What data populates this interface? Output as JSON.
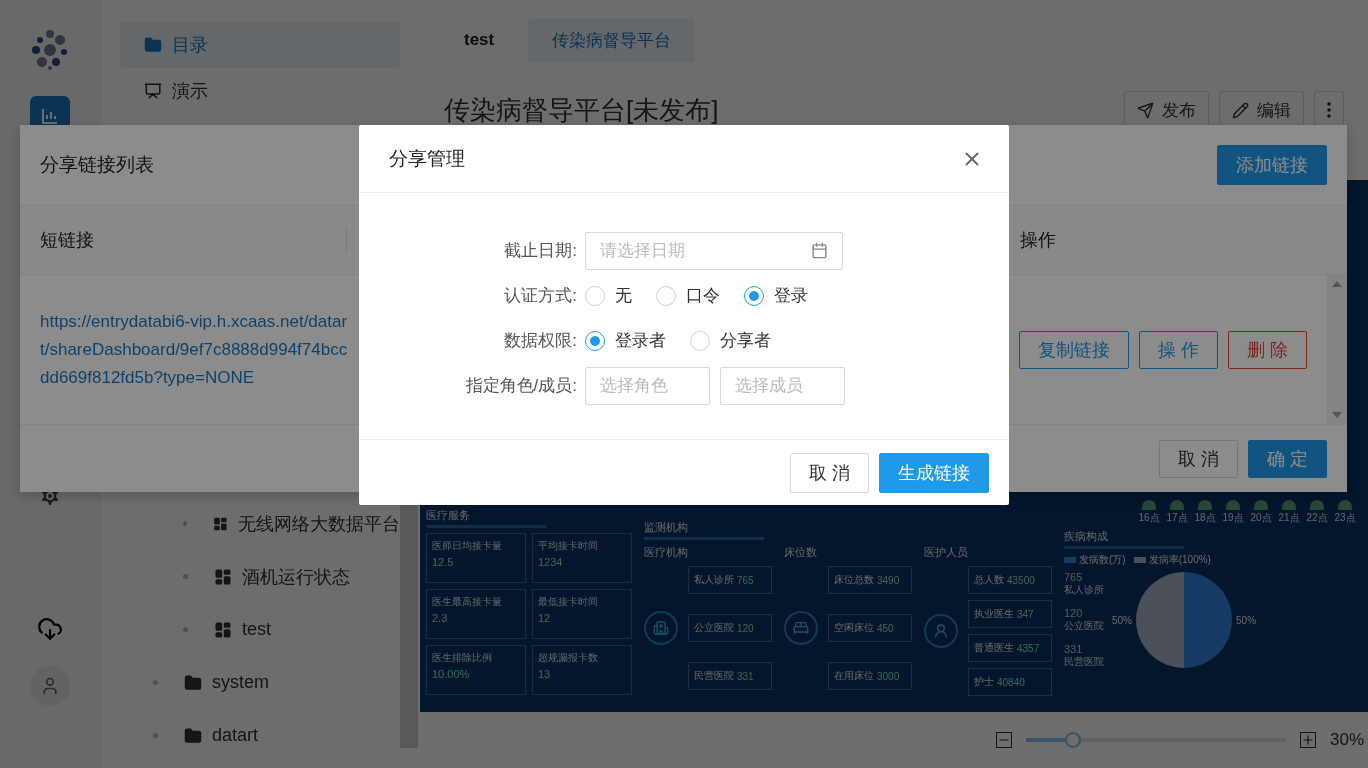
{
  "sidebar": {
    "sections": [
      {
        "label": "目录",
        "kind": "folder",
        "selected": true
      },
      {
        "label": "演示",
        "kind": "present",
        "selected": false
      }
    ],
    "tree": [
      {
        "children": [
          {
            "label": "无线网络大数据平台",
            "kind": "dashboard"
          },
          {
            "label": "酒机运行状态",
            "kind": "dashboard"
          },
          {
            "label": "test",
            "kind": "dashboard"
          }
        ]
      },
      {
        "label": "system",
        "kind": "folder"
      },
      {
        "label": "datart",
        "kind": "folder"
      }
    ]
  },
  "tabs": [
    {
      "label": "test",
      "selected": false
    },
    {
      "label": "传染病督导平台",
      "selected": true
    }
  ],
  "page_title": "传染病督导平台[未发布]",
  "toolbar": [
    {
      "kind": "publish",
      "label": "发布"
    },
    {
      "kind": "edit",
      "label": "编辑"
    },
    {
      "kind": "more"
    }
  ],
  "dashboard": {
    "hour_labels": [
      "16点",
      "17点",
      "18点",
      "19点",
      "20点",
      "21点",
      "22点",
      "23点"
    ],
    "service": {
      "title": "医疗服务",
      "cards": [
        {
          "label": "医师日均接卡量",
          "value": "12.5"
        },
        {
          "label": "平均接卡时间",
          "value": "1234"
        },
        {
          "label": "医生最高接卡量",
          "value": "2.3"
        },
        {
          "label": "最低接卡时间",
          "value": "12"
        },
        {
          "label": "医生排除比例",
          "value": "10.00%"
        },
        {
          "label": "超规漏报卡数",
          "value": "13"
        }
      ]
    },
    "monitor": {
      "title": "监测机构",
      "groups": [
        {
          "title": "医疗机构",
          "kind": "hospital",
          "items": [
            {
              "label": "私人诊所",
              "value": "765"
            },
            {
              "label": "公立医院",
              "value": "120"
            },
            {
              "label": "民营医院",
              "value": "331"
            }
          ]
        },
        {
          "title": "床位数",
          "kind": "bed",
          "items": [
            {
              "label": "床位总数",
              "value": "3490"
            },
            {
              "label": "空闲床位",
              "value": "450"
            },
            {
              "label": "在用床位",
              "value": "3000"
            }
          ]
        },
        {
          "title": "医护人员",
          "kind": "staff",
          "items": [
            {
              "label": "总人数",
              "value": "43500"
            },
            {
              "label": "执业医生",
              "value": "347"
            },
            {
              "label": "普通医生",
              "value": "4357"
            },
            {
              "label": "护士",
              "value": "40840"
            }
          ]
        }
      ]
    },
    "disease": {
      "title": "疾病构成",
      "legend": [
        {
          "label": "发病数(万)",
          "color": "#153a66"
        },
        {
          "label": "发病率(100%)",
          "color": "#4a4f58"
        }
      ],
      "stats": [
        {
          "value": "765",
          "label": "私人诊所"
        },
        {
          "value": "120",
          "label": "公立医院"
        },
        {
          "value": "331",
          "label": "民营医院"
        }
      ],
      "pie_labels": [
        "50%",
        "50%"
      ]
    }
  },
  "zoom": {
    "level": 0.18,
    "reading": "30%"
  },
  "share_list": {
    "title": "分享链接列表",
    "add_button": "添加链接",
    "columns": [
      "短链接",
      "操作"
    ],
    "rows": [
      {
        "link": "https://entrydatabi6-vip.h.xcaas.net/datart/shareDashboard/9ef7c8888d994f74bccdd669f812fd5b?type=NONE",
        "actions": [
          {
            "label": "复制链接",
            "kind": "primary"
          },
          {
            "label": "操 作",
            "kind": "primary"
          },
          {
            "label": "删 除",
            "kind": "danger"
          }
        ]
      }
    ],
    "buttons": [
      {
        "label": "取 消",
        "kind": "default"
      },
      {
        "label": "确 定",
        "kind": "primary"
      }
    ]
  },
  "share_modal": {
    "title": "分享管理",
    "fields": [
      {
        "kind": "date",
        "label": "截止日期:",
        "placeholder": "请选择日期"
      },
      {
        "kind": "radio",
        "label": "认证方式:",
        "options": [
          {
            "label": "无",
            "selected": false
          },
          {
            "label": "口令",
            "selected": false
          },
          {
            "label": "登录",
            "selected": true
          }
        ]
      },
      {
        "kind": "radio",
        "label": "数据权限:",
        "options": [
          {
            "label": "登录者",
            "selected": true
          },
          {
            "label": "分享者",
            "selected": false
          }
        ]
      },
      {
        "kind": "selects",
        "label": "指定角色/成员:",
        "placeholders": [
          "选择角色",
          "选择成员"
        ]
      }
    ],
    "buttons": [
      {
        "label": "取 消",
        "kind": "default"
      },
      {
        "label": "生成链接",
        "kind": "primary"
      }
    ]
  }
}
